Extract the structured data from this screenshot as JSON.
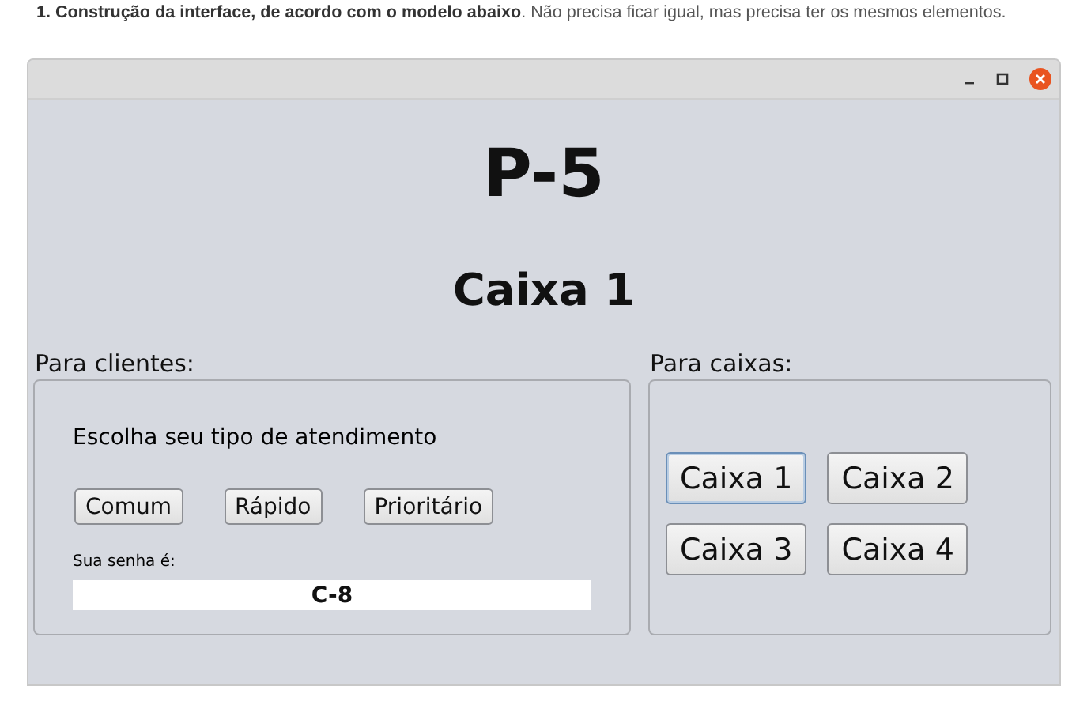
{
  "instruction": "**1. Construção da interface, de acordo com o modelo abaixo**. Não precisa ficar igual, mas precisa ter os mesmos elementos.",
  "ticket": "P-5",
  "counter": "Caixa 1",
  "clients": {
    "label": "Para clientes:",
    "prompt": "Escolha seu tipo de atendimento",
    "buttons": [
      "Comum",
      "Rápido",
      "Prioritário"
    ],
    "ticket_label": "Sua senha é:",
    "ticket_value": "C-8"
  },
  "cashiers": {
    "label": "Para caixas:",
    "buttons": [
      {
        "label": "Caixa 1",
        "focused": true
      },
      {
        "label": "Caixa 2",
        "focused": false
      },
      {
        "label": "Caixa 3",
        "focused": false
      },
      {
        "label": "Caixa 4",
        "focused": false
      }
    ]
  }
}
